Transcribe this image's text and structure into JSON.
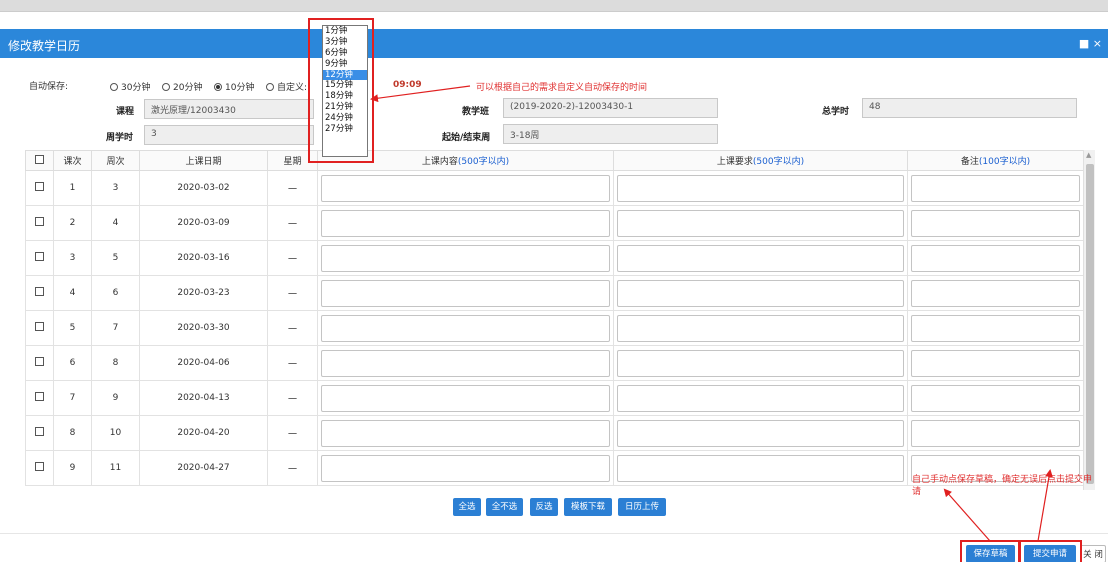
{
  "dialog": {
    "title": "修改教学日历",
    "controls": "■ ×"
  },
  "autosave": {
    "label": "自动保存:",
    "options": [
      "30分钟",
      "20分钟",
      "10分钟",
      "自定义:"
    ],
    "selected": "10分钟",
    "time": "09:09",
    "dropdown": [
      "1分钟",
      "3分钟",
      "6分钟",
      "9分钟",
      "12分钟",
      "15分钟",
      "18分钟",
      "21分钟",
      "24分钟",
      "27分钟"
    ],
    "dropdown_selected": "12分钟"
  },
  "annotations": {
    "top": "可以根据自己的需求自定义自动保存的时间",
    "bottom_line1": "自己手动点保存草稿，确定无误后点击提交申",
    "bottom_line2": "请",
    "color": "#e03030"
  },
  "fields": {
    "course_label": "课程",
    "course": "激光原理/12003430",
    "class_label": "教学班",
    "class": "(2019-2020-2)-12003430-1",
    "total_hours_label": "总学时",
    "total_hours": "48",
    "weekly_hours_label": "周学时",
    "weekly_hours": "3",
    "weeks_label": "起始/结束周",
    "weeks": "3-18周"
  },
  "table": {
    "headers": {
      "lesson": "课次",
      "week": "周次",
      "date": "上课日期",
      "weekday": "星期",
      "content": "上课内容",
      "content_limit": "(500字以内)",
      "requirement": "上课要求",
      "requirement_limit": "(500字以内)",
      "remark": "备注",
      "remark_limit": "(100字以内)"
    },
    "rows": [
      {
        "lesson": "1",
        "week": "3",
        "date": "2020-03-02",
        "weekday": "一"
      },
      {
        "lesson": "2",
        "week": "4",
        "date": "2020-03-09",
        "weekday": "一"
      },
      {
        "lesson": "3",
        "week": "5",
        "date": "2020-03-16",
        "weekday": "一"
      },
      {
        "lesson": "4",
        "week": "6",
        "date": "2020-03-23",
        "weekday": "一"
      },
      {
        "lesson": "5",
        "week": "7",
        "date": "2020-03-30",
        "weekday": "一"
      },
      {
        "lesson": "6",
        "week": "8",
        "date": "2020-04-06",
        "weekday": "一"
      },
      {
        "lesson": "7",
        "week": "9",
        "date": "2020-04-13",
        "weekday": "一"
      },
      {
        "lesson": "8",
        "week": "10",
        "date": "2020-04-20",
        "weekday": "一"
      },
      {
        "lesson": "9",
        "week": "11",
        "date": "2020-04-27",
        "weekday": "一"
      }
    ]
  },
  "toolbar": {
    "select_all": "全选",
    "select_none": "全不选",
    "invert": "反选",
    "template_download": "模板下载",
    "calendar_upload": "日历上传"
  },
  "footer": {
    "save_draft": "保存草稿",
    "submit": "提交申请",
    "close": "关 闭"
  },
  "colors": {
    "accent": "#2b87da",
    "button": "#2b7fd4",
    "highlight_box": "#e02020"
  }
}
